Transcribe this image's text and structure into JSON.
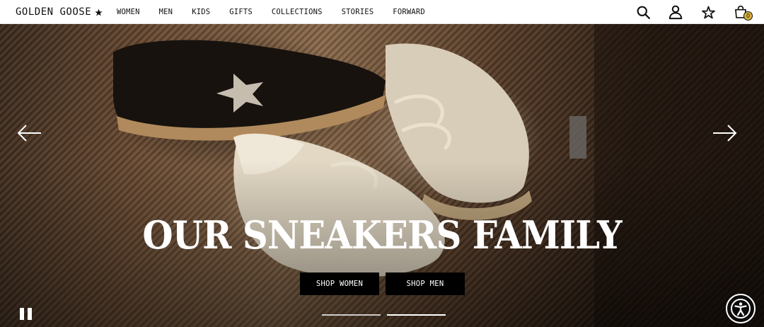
{
  "header": {
    "logo": "GOLDEN GOOSE",
    "nav": [
      "WOMEN",
      "MEN",
      "KIDS",
      "GIFTS",
      "COLLECTIONS",
      "STORIES",
      "FORWARD"
    ],
    "cart_count": "0",
    "icons": [
      "search-icon",
      "account-icon",
      "wishlist-star-icon",
      "cart-icon"
    ]
  },
  "hero": {
    "headline": "OUR SNEAKERS FAMILY",
    "cta_women": "SHOP WOMEN",
    "cta_men": "SHOP MEN",
    "slides_total": 2,
    "active_slide": 2
  },
  "colors": {
    "header_bg": "#ffffff",
    "text": "#111111",
    "cart_badge": "#d7b23a",
    "cta_bg": "#000000"
  }
}
